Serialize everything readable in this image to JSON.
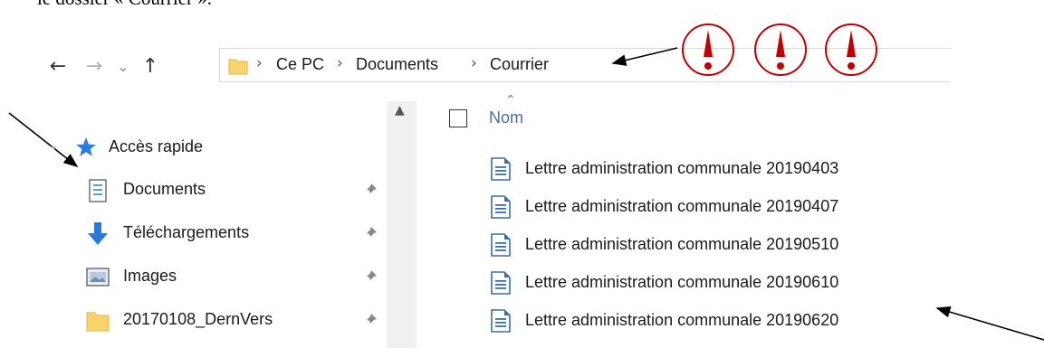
{
  "document_text": "le dossier « Courrier ».",
  "nav": {
    "back": "←",
    "forward": "→",
    "recent": "⌄",
    "up": "↑"
  },
  "breadcrumb": [
    {
      "label": "Ce PC"
    },
    {
      "label": "Documents"
    },
    {
      "label": "Courrier"
    }
  ],
  "breadcrumb_separator": "›",
  "sidebar": {
    "quick_access": "Accès rapide",
    "items": [
      {
        "label": "Documents",
        "icon": "documents-icon"
      },
      {
        "label": "Téléchargements",
        "icon": "download-arrow-icon"
      },
      {
        "label": "Images",
        "icon": "images-icon"
      },
      {
        "label": "20170108_DernVers",
        "icon": "folder-icon"
      }
    ]
  },
  "content": {
    "column_name": "Nom",
    "files": [
      "Lettre administration communale 20190403",
      "Lettre administration communale 20190407",
      "Lettre administration communale 20190510",
      "Lettre administration communale 20190610",
      "Lettre administration communale 20190620"
    ]
  },
  "colors": {
    "annotation_red": "#c00000",
    "folder_yellow": "#f8d46b",
    "column_header_blue": "#4a6ea0",
    "download_blue": "#2b78d8",
    "star_blue": "#2a7ae0"
  }
}
